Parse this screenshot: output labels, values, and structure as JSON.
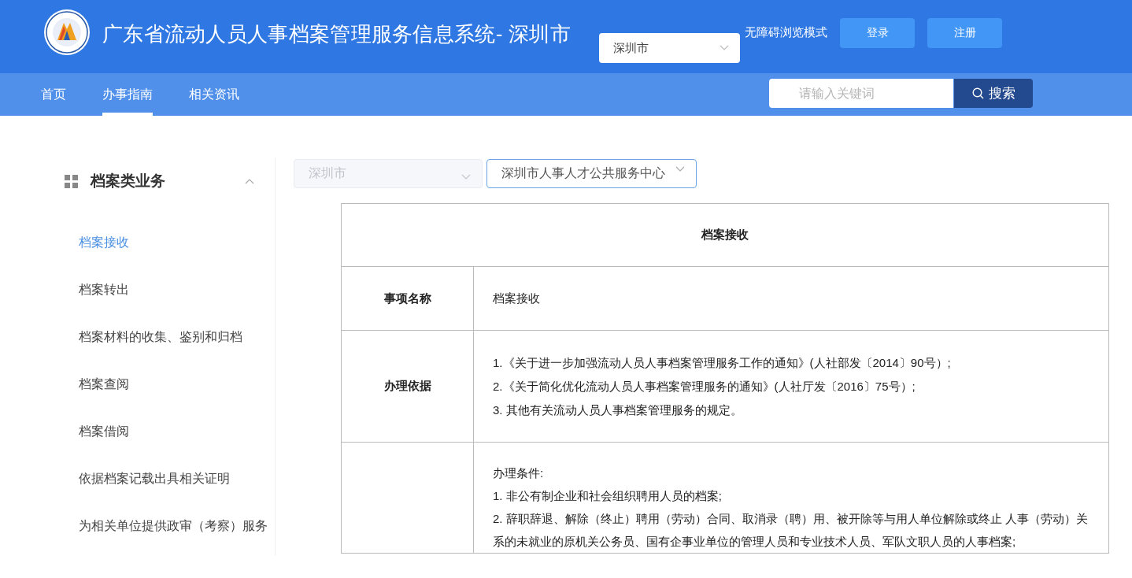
{
  "header": {
    "title": "广东省流动人员人事档案管理服务信息系统- 深圳市",
    "city_select": {
      "value": "深圳市"
    },
    "accessibility_link": "无障碍浏览模式",
    "buttons": [
      "登录",
      "注册"
    ]
  },
  "nav": {
    "items": [
      {
        "label": "首页",
        "selected": false
      },
      {
        "label": "办事指南",
        "selected": true
      },
      {
        "label": "相关资讯",
        "selected": false
      }
    ],
    "search": {
      "placeholder": "请输入关键词"
    },
    "search_button": "搜索"
  },
  "sidebar": {
    "title": "档案类业务",
    "expanded": true,
    "items": [
      {
        "label": "档案接收",
        "selected": true
      },
      {
        "label": "档案转出",
        "selected": false
      },
      {
        "label": "档案材料的收集、鉴别和归档",
        "selected": false
      },
      {
        "label": "档案查阅",
        "selected": false
      },
      {
        "label": "档案借阅",
        "selected": false
      },
      {
        "label": "依据档案记载出具相关证明",
        "selected": false
      },
      {
        "label": "为相关单位提供政审（考察）服务",
        "selected": false
      }
    ]
  },
  "filters": [
    {
      "value": "深圳市",
      "disabled": true
    },
    {
      "value": "深圳市人事人才公共服务中心",
      "disabled": false
    }
  ],
  "table": {
    "title": "档案接收",
    "rows": [
      {
        "label": "事项名称",
        "lines": [
          "档案接收"
        ]
      },
      {
        "label": "办理依据",
        "lines": [
          "1.《关于进一步加强流动人员人事档案管理服务工作的通知》(人社部发〔2014〕90号）;",
          "2.《关于简化优化流动人员人事档案管理服务的通知》(人社厅发〔2016〕75号）;",
          "3. 其他有关流动人员人事档案管理服务的规定。"
        ]
      },
      {
        "lines": [
          "办理条件:",
          "1. 非公有制企业和社会组织聘用人员的档案;",
          "2. 辞职辞退、解除（终止）聘用（劳动）合同、取消录（聘）用、被开除等与用人单位解除或终止 人事（劳动）关系的未就业的原机关公务员、国有企事业单位的管理人员和专业技术人员、军队文职人员的人事档案;"
        ]
      }
    ]
  }
}
